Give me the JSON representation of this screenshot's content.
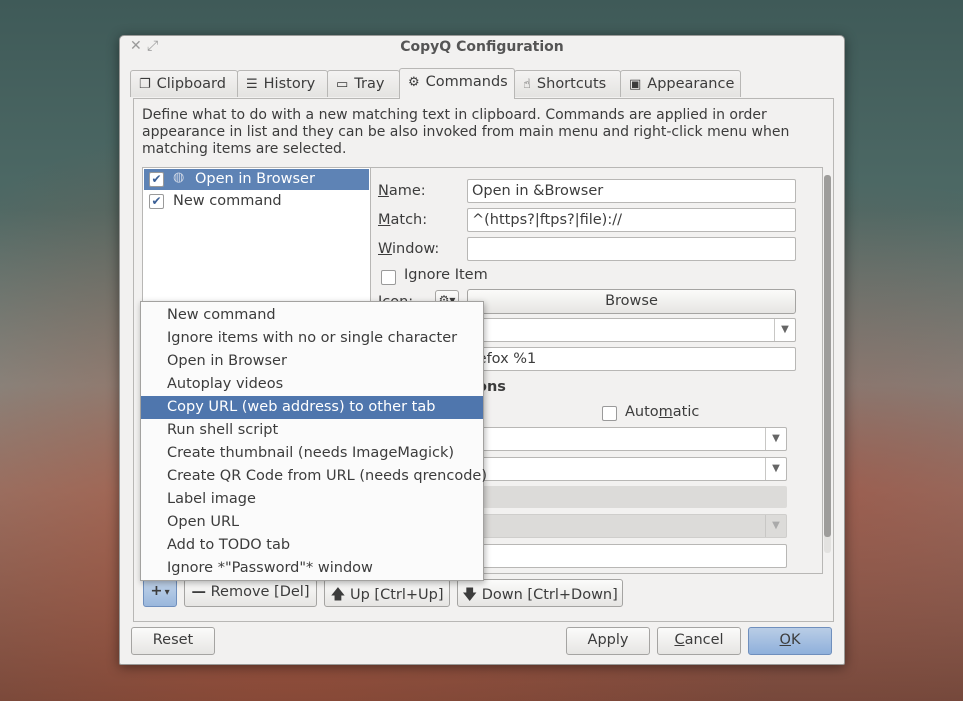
{
  "window": {
    "title": "CopyQ Configuration",
    "close_glyph": "✕",
    "maximize_glyph": "⤢"
  },
  "tabs": [
    {
      "label": "Clipboard",
      "icon": "clipboard-icon",
      "glyph": "❐"
    },
    {
      "label": "History",
      "icon": "list-icon",
      "glyph": "☰"
    },
    {
      "label": "Tray",
      "icon": "tray-icon",
      "glyph": "▭"
    },
    {
      "label": "Commands",
      "icon": "gears-icon",
      "glyph": "⚙"
    },
    {
      "label": "Shortcuts",
      "icon": "hand-pointer-icon",
      "glyph": "☝"
    },
    {
      "label": "Appearance",
      "icon": "image-icon",
      "glyph": "▣"
    }
  ],
  "active_tab": "Commands",
  "description": "Define what to do with a new matching text in clipboard. Commands are applied in order appearance in list and they can be also invoked from main menu and right-click menu when matching items are selected.",
  "commands": [
    {
      "label": "Open in Browser",
      "checked": true,
      "selected": true,
      "icon": "globe-icon"
    },
    {
      "label": "New command",
      "checked": true,
      "selected": false
    }
  ],
  "form": {
    "name_label": "Name:",
    "name_value": "Open in &Browser",
    "match_label": "Match:",
    "match_value": "^(https?|ftps?|file)://",
    "window_label": "Window:",
    "window_value": "",
    "ignore_item_label": "Ignore Item",
    "icon_label": "Icon:",
    "browse_label": "Browse",
    "command_partial": "refox %1",
    "options_partial": "ons",
    "automatic_label": "Automatic"
  },
  "menu_items": [
    "New command",
    "Ignore items with no or single character",
    "Open in Browser",
    "Autoplay videos",
    "Copy URL (web address) to other tab",
    "Run shell script",
    "Create thumbnail (needs ImageMagick)",
    "Create QR Code from URL (needs qrencode)",
    "Label image",
    "Open URL",
    "Add to TODO tab",
    "Ignore *\"Password\"* window"
  ],
  "menu_highlighted": "Copy URL (web address) to other tab",
  "list_buttons": {
    "add_glyph": "+",
    "add_arrow": "▾",
    "remove": "Remove [Del]",
    "remove_glyph": "—",
    "up": "Up [Ctrl+Up]",
    "up_glyph": "🡅",
    "down": "Down [Ctrl+Down]",
    "down_glyph": "🡇"
  },
  "footer": {
    "reset": "Reset",
    "apply": "Apply",
    "cancel": "Cancel",
    "ok": "OK"
  },
  "colors": {
    "selection": "#5e83b5",
    "menu_highlight": "#4f76ad",
    "window_bg": "#f2f1f0"
  }
}
